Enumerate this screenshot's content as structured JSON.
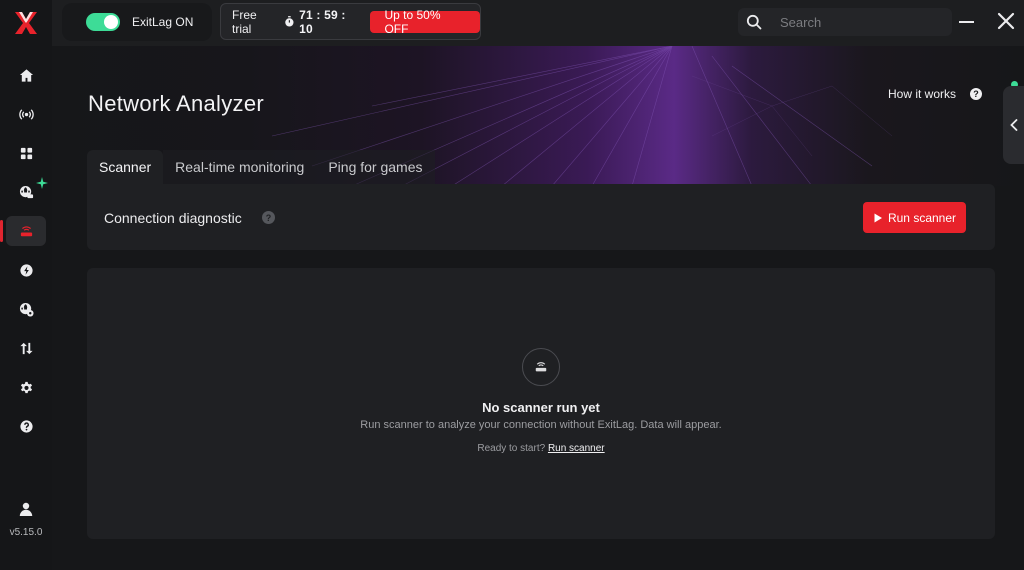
{
  "colors": {
    "accent_red": "#e8222b",
    "toggle_green": "#3ddc97",
    "sidebar_bg": "#151618",
    "card_bg": "#1f2023",
    "hero_purple": "#5a2a86"
  },
  "sidebar": {
    "logo": "exitlag-logo",
    "items": [
      {
        "icon": "home-icon"
      },
      {
        "icon": "broadcast-icon"
      },
      {
        "icon": "grid-icon"
      },
      {
        "icon": "globe-route-icon"
      },
      {
        "icon": "router-icon"
      },
      {
        "icon": "lightning-icon"
      },
      {
        "icon": "globe-settings-icon"
      },
      {
        "icon": "transfer-arrows-icon"
      },
      {
        "icon": "gear-icon"
      },
      {
        "icon": "help-icon"
      }
    ],
    "active_index": 4,
    "version": "v5.15.0"
  },
  "topbar": {
    "toggle_label": "ExitLag ON",
    "toggle_on": true,
    "trial_label": "Free trial",
    "timer": "71 : 59 : 10",
    "offer_label": "Up to 50% OFF",
    "search_placeholder": "Search"
  },
  "main": {
    "title": "Network Analyzer",
    "how_it_works": "How it works",
    "tabs": [
      {
        "label": "Scanner"
      },
      {
        "label": "Real-time monitoring"
      },
      {
        "label": "Ping for games"
      }
    ],
    "active_tab": 0,
    "diagnostic": {
      "label": "Connection diagnostic",
      "run_button": "Run scanner"
    },
    "empty": {
      "title": "No scanner run yet",
      "description": "Run scanner to analyze your connection without ExitLag. Data will appear.",
      "cta_prefix": "Ready to start?",
      "cta_link": "Run scanner"
    }
  }
}
